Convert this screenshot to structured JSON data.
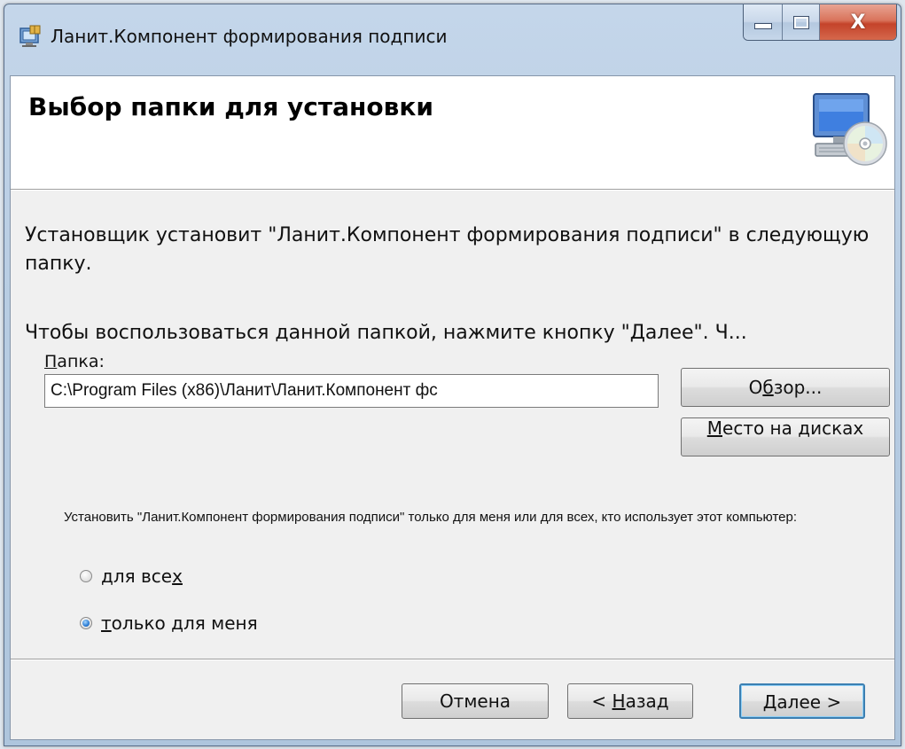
{
  "window": {
    "title": "Ланит.Компонент формирования подписи",
    "minimize_glyph": "",
    "close_glyph": "X"
  },
  "banner": {
    "title": "Выбор папки для установки",
    "icon": "computer-cd-icon"
  },
  "body": {
    "intro": "Установщик установит \"Ланит.Компонент формирования подписи\" в следующую папку.",
    "instruction": "Чтобы воспользоваться данной папкой, нажмите кнопку \"Далее\". Ч...",
    "folder_label_key": "П",
    "folder_label_rest": "апка:",
    "folder_path": "C:\\Program Files (x86)\\Ланит\\Ланит.Компонент фс",
    "browse_pre": "О",
    "browse_key": "б",
    "browse_post": "зор...",
    "disk_key": "М",
    "disk_rest": "есто на дисках",
    "install_for": "Установить \"Ланит.Компонент формирования подписи\" только для меня или для всех, кто использует этот компьютер:",
    "radio_all_pre": "для все",
    "radio_all_key": "х",
    "radio_me_key": "т",
    "radio_me_rest": "олько для меня",
    "selected": "only_me"
  },
  "footer": {
    "cancel": "Отмена",
    "back_arrow": "<",
    "back_key": "Н",
    "back_rest": "азад",
    "next_key": "Д",
    "next_rest": "алее",
    "next_arrow": ">"
  },
  "colors": {
    "title_bar": "#b8cde3",
    "close_button": "#c4432a",
    "default_button_border": "#3c7fb1",
    "dialog_background": "#f0f0f0"
  }
}
